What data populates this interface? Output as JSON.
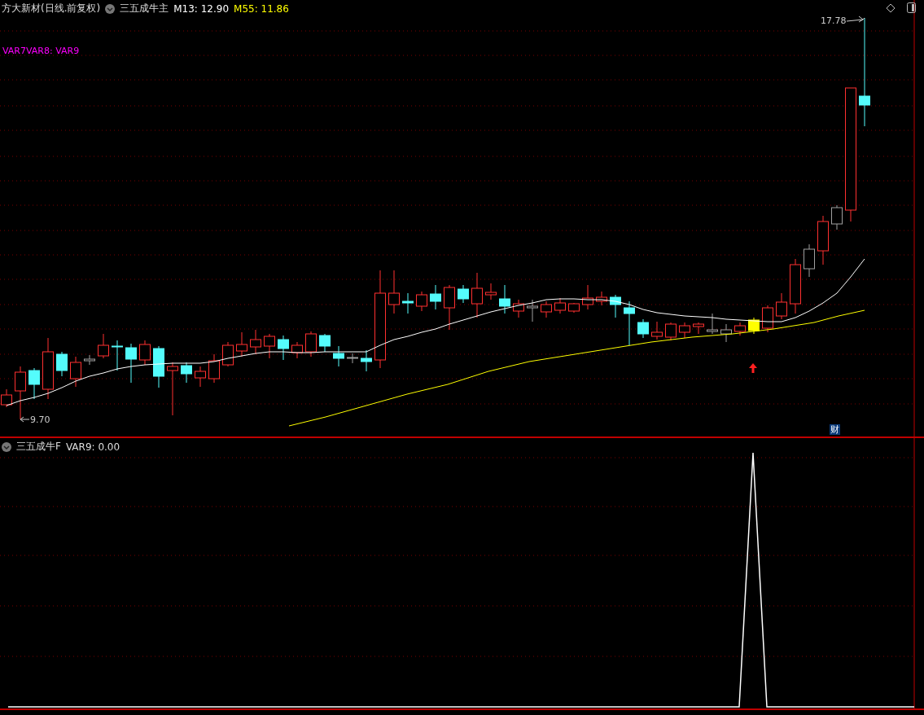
{
  "main_panel": {
    "stock_title": "方大新材(日线.前复权)",
    "indicator": "三五成牛主",
    "values": [
      {
        "label": "M13: 12.90",
        "color": "#ffffff"
      },
      {
        "label": "M55: 11.86",
        "color": "#ffff00"
      }
    ],
    "legend": "VAR7VAR8: VAR9",
    "high_label": "17.78",
    "low_label": "9.70",
    "badge": "财"
  },
  "sub_panel": {
    "indicator": "三五成牛F",
    "value": "VAR9: 0.00"
  }
}
